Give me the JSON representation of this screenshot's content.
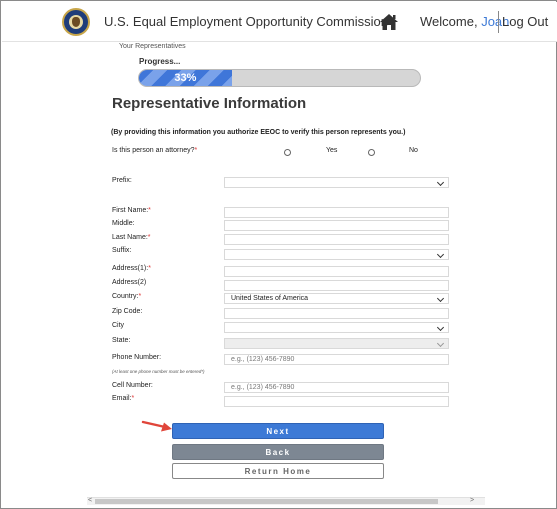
{
  "header": {
    "agency_name": "U.S. Equal Employment Opportunity Commission",
    "welcome_text": "Welcome,",
    "user_name": "Joan",
    "logout_label": "Log Out"
  },
  "breadcrumb": "Your Representatives",
  "progress": {
    "label": "Progress...",
    "percent_text": "33%",
    "value": 0.33
  },
  "section_title": "Representative Information",
  "authorize_text": "(By providing this information you authorize EEOC to verify this person represents you.)",
  "attorney_question": {
    "label": "Is this person an attorney?",
    "required_mark": "*",
    "options": [
      "Yes",
      "No"
    ]
  },
  "fields": {
    "prefix": {
      "label": "Prefix:",
      "value": ""
    },
    "first_name": {
      "label": "First Name:",
      "required_mark": "*",
      "value": ""
    },
    "middle": {
      "label": "Middle:",
      "value": ""
    },
    "last_name": {
      "label": "Last Name:",
      "required_mark": "*",
      "value": ""
    },
    "suffix": {
      "label": "Suffix:",
      "value": ""
    },
    "address1": {
      "label": "Address(1):",
      "required_mark": "*",
      "value": ""
    },
    "address2": {
      "label": "Address(2)",
      "value": ""
    },
    "country": {
      "label": "Country:",
      "required_mark": "*",
      "value": "United States of America"
    },
    "zip": {
      "label": "Zip Code:",
      "value": ""
    },
    "city": {
      "label": "City",
      "value": ""
    },
    "state": {
      "label": "State:",
      "value": ""
    },
    "phone": {
      "label": "Phone Number:",
      "placeholder": "e.g., (123) 456-7890"
    },
    "phone_note": "(At least one phone number must be entered*)",
    "cell": {
      "label": "Cell Number:",
      "placeholder": "e.g., (123) 456-7890"
    },
    "email": {
      "label": "Email:",
      "required_mark": "*",
      "value": ""
    }
  },
  "buttons": {
    "next": "Next",
    "back": "Back",
    "return_home": "Return Home"
  },
  "scrollbar": {
    "left_arrow": "<",
    "right_arrow": ">"
  },
  "colors": {
    "accent_blue": "#3d7ad6",
    "back_gray": "#7d8793",
    "required_red": "#d33",
    "arrow_red": "#e0453a"
  },
  "icons": {
    "seal": "eeoc-seal-icon",
    "home": "home-icon",
    "pointer": "red-arrow-icon"
  }
}
